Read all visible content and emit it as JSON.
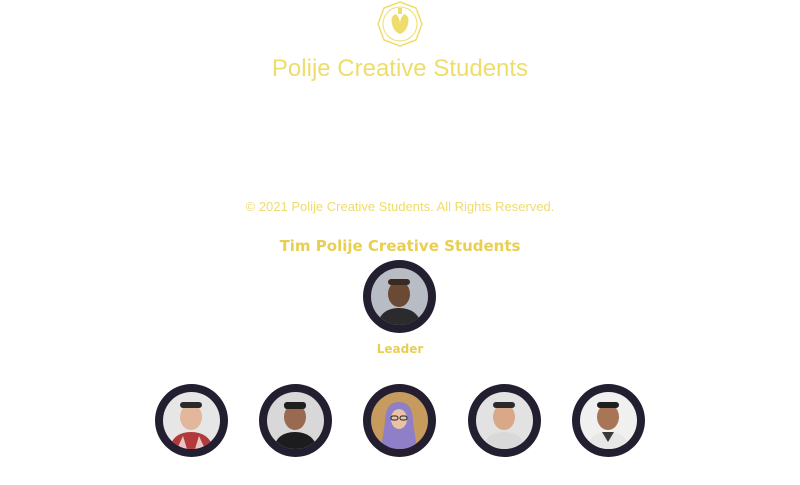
{
  "header": {
    "logo_icon": "polije-emblem-icon",
    "title": "Polije Creative Students"
  },
  "footer": {
    "copyright": "© 2021 Polije Creative Students. All Rights Reserved."
  },
  "team": {
    "heading": "Tim Polije Creative Students",
    "leader": {
      "role": "Leader",
      "photo_icon": "leader-photo"
    },
    "members": [
      {
        "photo_icon": "member-photo-1"
      },
      {
        "photo_icon": "member-photo-2"
      },
      {
        "photo_icon": "member-photo-3"
      },
      {
        "photo_icon": "member-photo-4"
      },
      {
        "photo_icon": "member-photo-5"
      }
    ]
  },
  "colors": {
    "accent_yellow": "#eedd6b",
    "avatar_ring": "#231f31",
    "background": "#ffffff"
  }
}
